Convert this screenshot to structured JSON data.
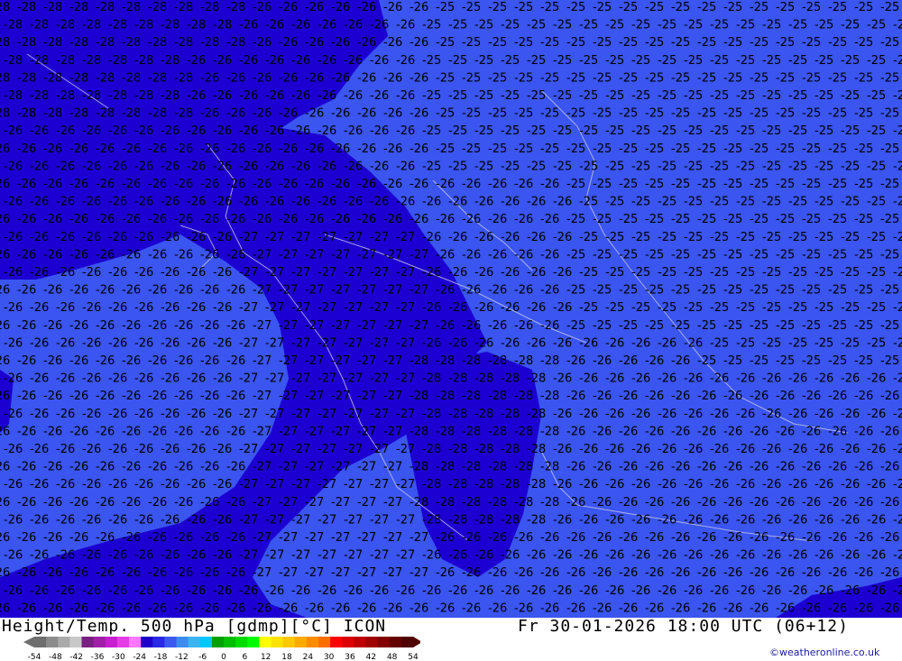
{
  "map": {
    "contour_labels": [
      "-25",
      "-26",
      "-27",
      "-28"
    ],
    "city_label": "-26",
    "colors": {
      "ocean_light": "#3a55f0",
      "dark_region": "#1c00d2",
      "borders": "#c8c8e6"
    }
  },
  "footer": {
    "title": "Height/Temp. 500 hPa [gdmp][°C] ICON",
    "time": "Fr 30-01-2026 18:00 UTC (06+12)",
    "credit": "©weatheronline.co.uk"
  },
  "legend": {
    "tick_labels": [
      "-54",
      "-48",
      "-42",
      "-36",
      "-30",
      "-24",
      "-18",
      "-12",
      "-6",
      "0",
      "6",
      "12",
      "18",
      "24",
      "30",
      "36",
      "42",
      "48",
      "54"
    ],
    "colors": [
      "#6e6e6e",
      "#8c8c8c",
      "#aaaaaa",
      "#c8c8c8",
      "#7a1f82",
      "#a01ea8",
      "#c81ed2",
      "#e63ce6",
      "#ff78ff",
      "#1e00c8",
      "#2828e6",
      "#3c5af0",
      "#3c8cf0",
      "#3cb4f0",
      "#00c8ff",
      "#00a000",
      "#00be00",
      "#00dc00",
      "#00fa00",
      "#ffff00",
      "#ffe100",
      "#ffc800",
      "#ffaa00",
      "#ff8c00",
      "#ff6e00",
      "#ff0000",
      "#dc0000",
      "#be0000",
      "#a00000",
      "#820000",
      "#640000",
      "#500000"
    ]
  }
}
